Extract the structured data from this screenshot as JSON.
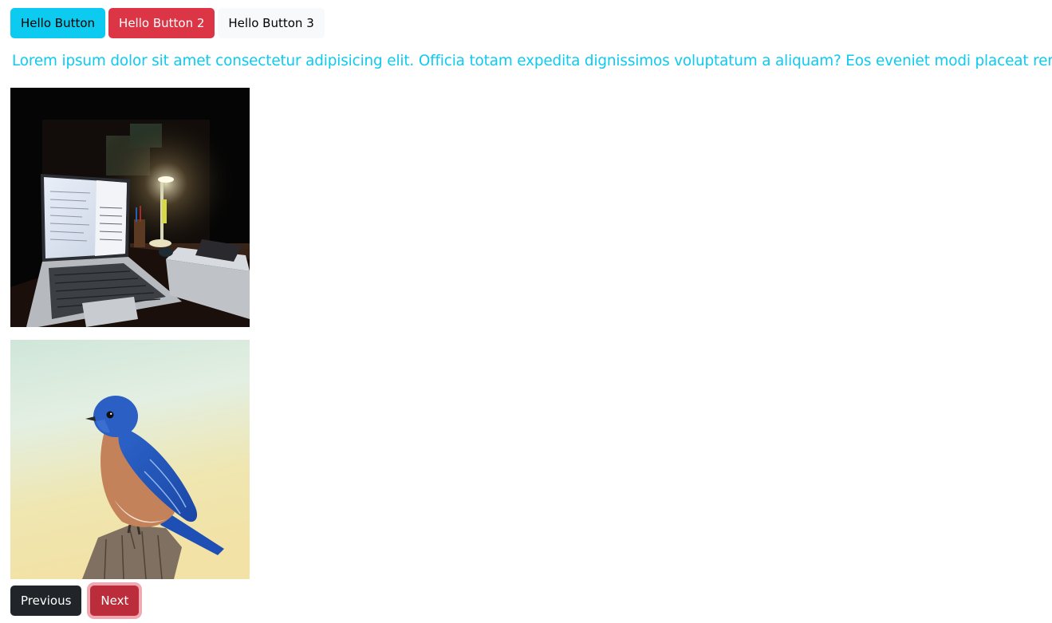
{
  "top_buttons": {
    "button1": "Hello Button",
    "button2": "Hello Button 2",
    "button3": "Hello Button 3"
  },
  "paragraph": "Lorem ipsum dolor sit amet consectetur adipisicing elit. Officia totam expedita dignissimos voluptatum a aliquam? Eos eveniet modi placeat rerum.",
  "images": [
    {
      "icon": "laptop-desk-photo"
    },
    {
      "icon": "bluebird-photo"
    }
  ],
  "pagination": {
    "previous": "Previous",
    "next": "Next"
  },
  "colors": {
    "info": "#0dcaf0",
    "danger": "#dc3545",
    "light": "#f8f9fa",
    "dark": "#212529",
    "next_active": "#bb2d3b"
  }
}
